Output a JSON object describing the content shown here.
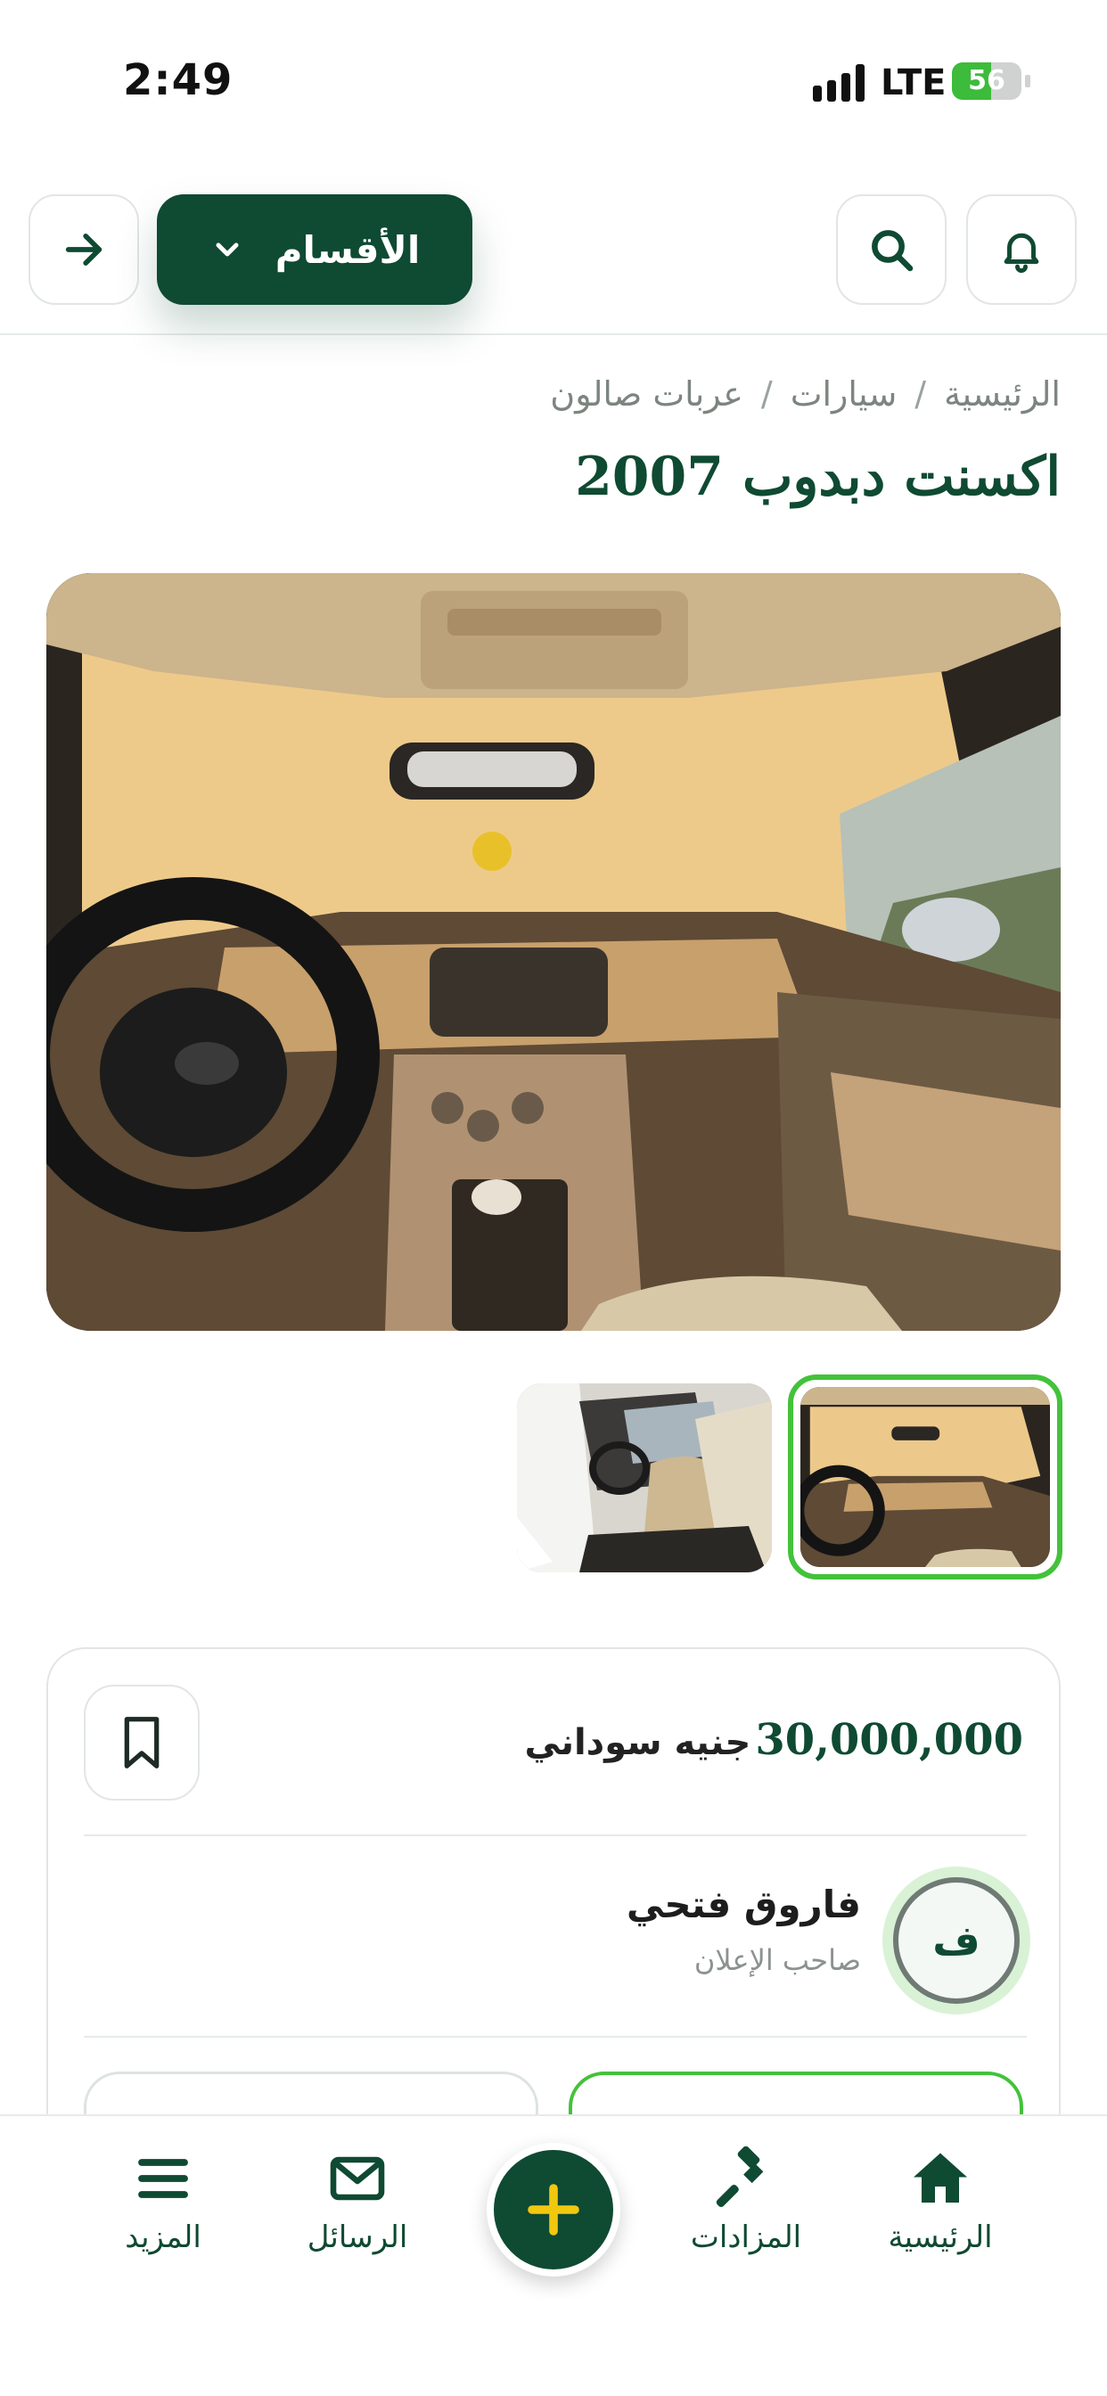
{
  "status_bar": {
    "time": "2:49",
    "network": "LTE",
    "battery_level": "56"
  },
  "header": {
    "categories_label": "الأقسام",
    "icons": {
      "back": "arrow-right-icon",
      "categories": "chevron-down-icon",
      "search": "search-icon",
      "notifications": "bell-icon"
    }
  },
  "breadcrumb": {
    "items": [
      "الرئيسية",
      "سيارات",
      "عربات صالون"
    ],
    "separator": "/"
  },
  "listing": {
    "title": "اكسنت دبدوب 2007",
    "price_amount": "30,000,000",
    "price_currency": "جنيه سوداني",
    "seller": {
      "initial": "ف",
      "name": "فاروق فتحي",
      "role": "صاحب الإعلان"
    },
    "photos": {
      "main": "car-interior-dashboard-photo",
      "thumbnails": [
        "car-interior-dashboard-photo",
        "car-interior-door-open-photo"
      ],
      "selected_index": 0
    }
  },
  "bottom_nav": {
    "items": [
      {
        "label": "الرئيسية",
        "icon": "home-icon"
      },
      {
        "label": "المزادات",
        "icon": "gavel-icon"
      },
      {
        "label": "الرسائل",
        "icon": "mail-icon"
      },
      {
        "label": "المزيد",
        "icon": "menu-icon"
      }
    ],
    "add_icon": "plus-icon"
  },
  "colors": {
    "primary": "#0f4a32",
    "accent_green": "#43c23a",
    "fab_plus": "#f2c80f"
  }
}
